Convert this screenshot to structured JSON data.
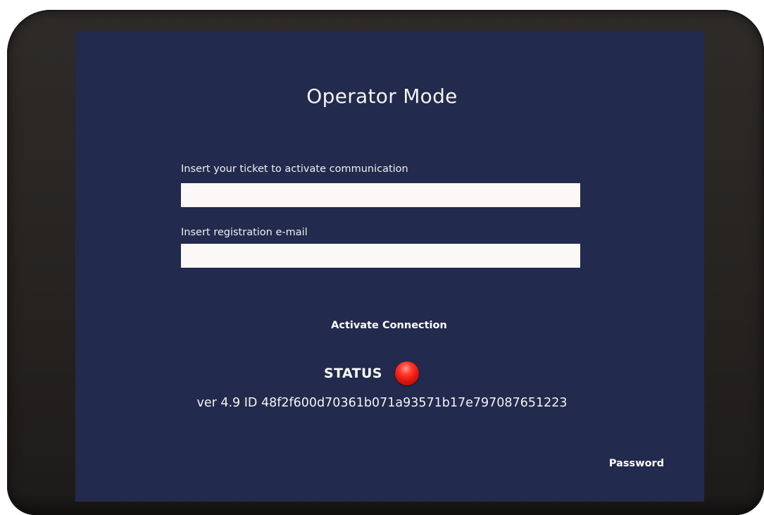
{
  "screen": {
    "title": "Operator Mode",
    "ticket_field": {
      "label": "Insert your ticket to activate communication",
      "value": "",
      "placeholder": ""
    },
    "email_field": {
      "label": "Insert registration e-mail",
      "value": "",
      "placeholder": ""
    },
    "activate_button_label": "Activate Connection",
    "status": {
      "label": "STATUS",
      "indicator_color": "#e0140c",
      "indicator_icon": "red-status-led-icon"
    },
    "version_text": "ver 4.9 ID 48f2f600d70361b071a93571b17e797087651223",
    "password_button_label": "Password"
  },
  "colors": {
    "screen_background": "#222a4d",
    "input_background": "#fdf8f8",
    "text": "#ffffff"
  }
}
